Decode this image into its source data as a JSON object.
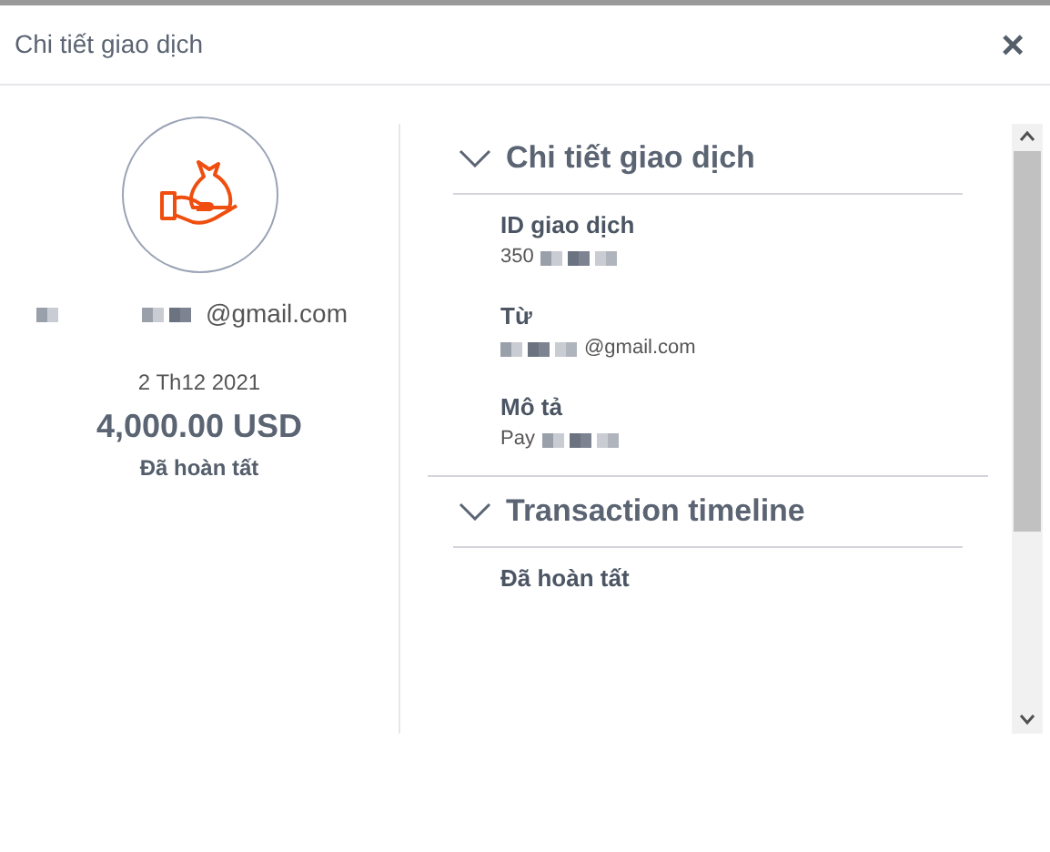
{
  "dialog": {
    "title": "Chi tiết giao dịch",
    "close": "×"
  },
  "summary": {
    "email": "@gmail.com",
    "date": "2 Th12 2021",
    "amount": "4,000.00 USD",
    "status": "Đã hoàn tất"
  },
  "sections": [
    {
      "title": "Chi tiết giao dịch",
      "expanded": true,
      "fields": [
        {
          "label": "ID giao dịch",
          "value": "350",
          "masked_before": false
        },
        {
          "label": "Từ",
          "value": "@gmail.com",
          "masked_before": true
        },
        {
          "label": "Mô tả",
          "value": "Pay",
          "masked_before": false
        }
      ]
    },
    {
      "title": "Transaction timeline",
      "expanded": true,
      "fields": [
        {
          "label": "Đã hoàn tất"
        }
      ]
    }
  ]
}
